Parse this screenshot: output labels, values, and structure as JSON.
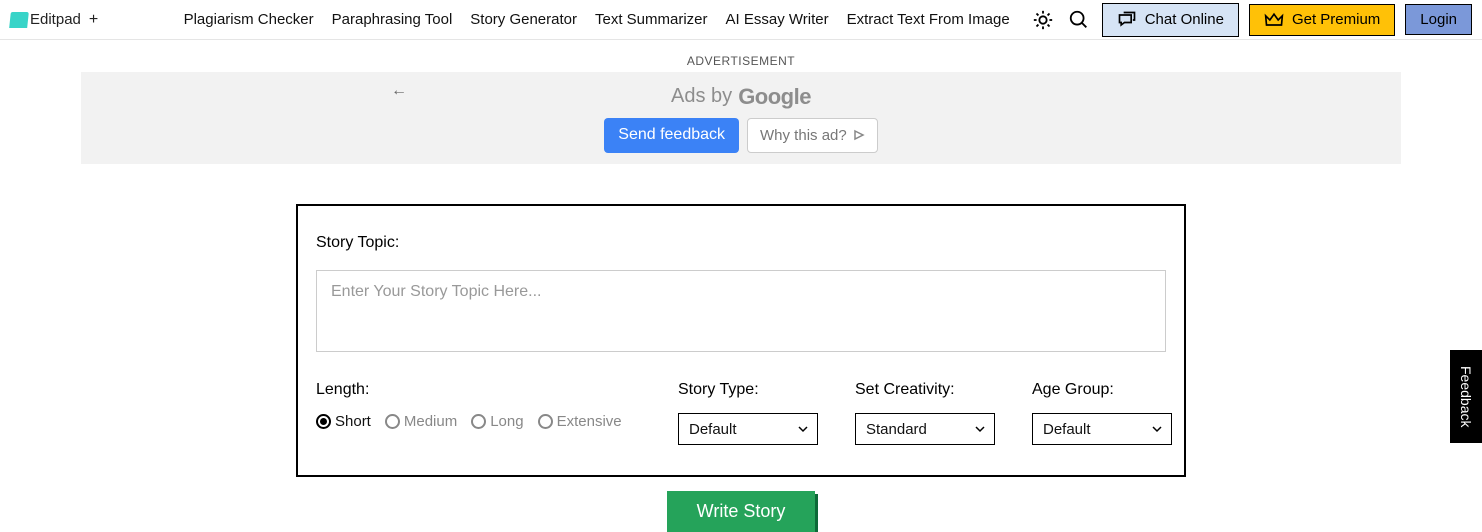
{
  "header": {
    "logo_text": "Editpad",
    "nav": [
      "Plagiarism Checker",
      "Paraphrasing Tool",
      "Story Generator",
      "Text Summarizer",
      "AI Essay Writer",
      "Extract Text From Image"
    ],
    "chat_label": "Chat Online",
    "premium_label": "Get Premium",
    "login_label": "Login"
  },
  "ad": {
    "label": "ADVERTISEMENT",
    "ads_by": "Ads by",
    "google_text": "Google",
    "feedback_btn": "Send feedback",
    "why_btn": "Why this ad?"
  },
  "form": {
    "topic_label": "Story Topic:",
    "topic_placeholder": "Enter Your Story Topic Here...",
    "length_label": "Length:",
    "length_options": [
      "Short",
      "Medium",
      "Long",
      "Extensive"
    ],
    "length_selected": "Short",
    "story_type_label": "Story Type:",
    "story_type_value": "Default",
    "creativity_label": "Set Creativity:",
    "creativity_value": "Standard",
    "age_label": "Age Group:",
    "age_value": "Default",
    "submit_label": "Write Story"
  },
  "feedback_tab": "Feedback"
}
